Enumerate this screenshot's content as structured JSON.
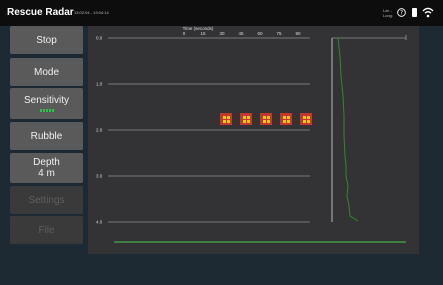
{
  "header": {
    "title": "Rescue Radar",
    "time_range": "13:02:04 - 13:04:14",
    "lat_label": "Lat: -",
    "long_label": "Long:"
  },
  "sidebar": {
    "stop": "Stop",
    "mode": "Mode",
    "sensitivity": "Sensitivity",
    "sensitivity_level": 5,
    "rubble": "Rubble",
    "depth": "Depth",
    "depth_value": "4 m",
    "settings": "Settings",
    "file": "File"
  },
  "plot": {
    "time_axis_title": "Time (seconds)",
    "time_ticks": [
      "0",
      "15",
      "30",
      "45",
      "60",
      "75",
      "90"
    ],
    "depth_ticks": [
      "0.0",
      "1.0",
      "2.0",
      "3.0",
      "4.0"
    ],
    "detections_count": 5,
    "colors": {
      "detection": "#c0392b",
      "detection_dots": "#f1c40f",
      "trace": "#2e8b2e",
      "baseline": "#3f7f3f",
      "grid": "#bbbbbb"
    }
  }
}
